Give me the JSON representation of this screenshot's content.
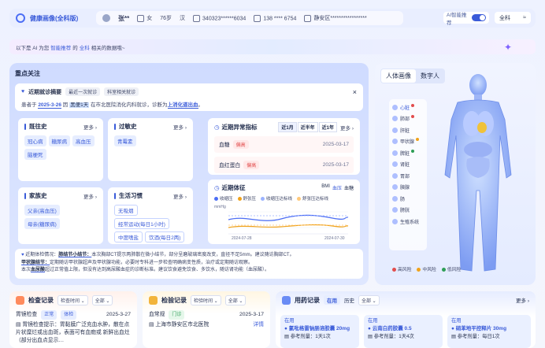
{
  "header": {
    "app_title": "健康画像(全科版)",
    "patient_name": "张**",
    "gender": "女",
    "age": "76岁",
    "ethnicity": "汉",
    "id_number": "340323******6034",
    "phone": "138 **** 6754",
    "address": "静安区*****************",
    "ai_toggle_label": "AI智能推荐",
    "scope_label": "全科",
    "scope_icon": "≈"
  },
  "banner": {
    "prefix": "以下是 AI 为您",
    "link": "智能推荐",
    "middle": "的",
    "scope": "全科",
    "suffix": "相关的数据哦~"
  },
  "focus": {
    "title": "重点关注",
    "visit": {
      "title": "近期就诊摘要",
      "tag1": "最近一次就诊",
      "tag2": "科室相关就诊",
      "line_prefix": "患者于",
      "date": "2025-3-26",
      "because": "因",
      "complaint": "黑便1天",
      "middle": "在市北医院消化内科就诊，诊断为",
      "diagnosis": "上消化道出血",
      "end": "。",
      "close": "×"
    },
    "history": {
      "title": "既往史",
      "more": "更多 ›",
      "chips": [
        "冠心病",
        "糖尿病",
        "高血压",
        "脑梗死"
      ]
    },
    "allergy": {
      "title": "过敏史",
      "more": "更多 ›",
      "chips": [
        "青霉素"
      ]
    },
    "family": {
      "title": "家族史",
      "more": "更多 ›",
      "chips": [
        "父亲(高血压)",
        "母亲(糖尿病)"
      ]
    },
    "lifestyle": {
      "title": "生活习惯",
      "more": "更多 ›",
      "chips": [
        "无吸烟",
        "经常运动(每日1小时)",
        "中度嗜盐",
        "饮酒(每日2两)"
      ]
    },
    "abnormal": {
      "title": "近期异常指标",
      "seg": [
        "近1月",
        "近半年",
        "近1年"
      ],
      "more": "更多 ›",
      "rows": [
        {
          "name": "血糖",
          "flag": "偏高",
          "date": "2025-03-17"
        },
        {
          "name": "血红蛋白",
          "flag": "偏高",
          "date": "2025-03-17"
        }
      ]
    },
    "vitals": {
      "title": "近期体征",
      "tabs": [
        "BMI",
        "血压",
        "血糖"
      ],
      "legend": [
        "收缩压",
        "舒张压",
        "收缩压达标线",
        "舒张压达标线"
      ],
      "unit": "mmHg",
      "date_start": "2024-07-28",
      "date_end": "2024-07-30"
    },
    "note": {
      "label1": "近期体检情况：",
      "tag1": "肺结节小结节：",
      "text1": "本次胸部CT提示两肺散在微小结节，部分呈磨玻璃密度改变，直径不足5mm。建议随访胸部CT。",
      "tag2": "甲状腺结节：",
      "text2": "定期随访甲状腺超声及甲状腺功能，必要时专科进一步检查明确病变性质，治疗或定期随访观察。",
      "label3": "本次",
      "tag3": "血尿酸",
      "text3": "超过正常值上限，但没有达到高尿酸血症的诊断标准。建议饮食避免饮食、多饮水，随访肾功能（血尿酸）。"
    }
  },
  "body_model": {
    "tabs": [
      "人体画像",
      "数字人"
    ],
    "organs": [
      "心脏",
      "肺部",
      "肝脏",
      "甲状腺",
      "脾脏",
      "肾脏",
      "胃部",
      "胰腺",
      "肠",
      "膀胱",
      "生殖系统"
    ],
    "legend": [
      "高风险",
      "中风险",
      "低风险"
    ]
  },
  "exam": {
    "title": "检查记录",
    "filter1": "检查时间 ⌄",
    "filter2": "全部 ⌄",
    "item_name": "胃镜检查",
    "tag_normal": "正常",
    "tag_exam": "体检",
    "item_date": "2025-3-27",
    "desc": "胃镜检查提示：胃黏膜广泛充血水肿，散在点片状糜烂或出血斑，表面可有血痂或",
    "desc2": "新鲜出血灶（部分出血点显示…"
  },
  "lab": {
    "title": "检验记录",
    "filter1": "检验时间 ⌄",
    "filter2": "全部 ⌄",
    "item_name": "血常规",
    "tag": "门诊",
    "item_date": "2025-3-17",
    "hospital": "上海市静安区市北医院",
    "detail": "详情"
  },
  "meds": {
    "title": "用药记录",
    "tabs": [
      "在用",
      "历史"
    ],
    "filter": "全部 ⌄",
    "more": "更多 ›",
    "items": [
      {
        "status": "在用",
        "name": "氯吡格雷钠肠溶胶囊 20mg",
        "dose": "参考剂量：1天1次"
      },
      {
        "status": "在用",
        "name": "云南白药胶囊 0.5",
        "dose": "参考剂量：1天4次"
      },
      {
        "status": "在用",
        "name": "硝苯地平控释片 30mg",
        "dose": "参考剂量：每日1次"
      }
    ]
  },
  "colors": {
    "accent": "#3a5bd9",
    "high_risk": "#e24d4d",
    "mid_risk": "#f0a21a",
    "low_risk": "#2e9e56"
  }
}
